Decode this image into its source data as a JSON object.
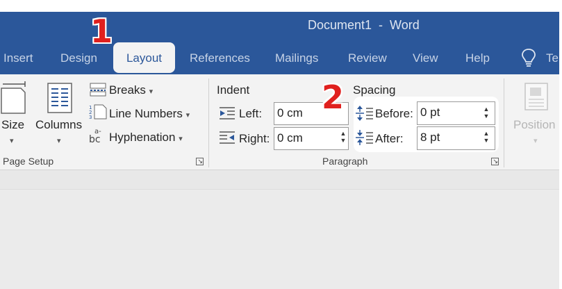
{
  "window": {
    "title": "Document1  -  Word"
  },
  "tabs": [
    "Insert",
    "Design",
    "Layout",
    "References",
    "Mailings",
    "Review",
    "View",
    "Help"
  ],
  "active_tab": "Layout",
  "tell_me_partial": "Te",
  "page_setup": {
    "size_label": "Size",
    "columns_label": "Columns",
    "breaks_label": "Breaks",
    "line_numbers_label": "Line Numbers",
    "hyphenation_label": "Hyphenation",
    "group_label": "Page Setup"
  },
  "paragraph": {
    "indent_header": "Indent",
    "spacing_header": "Spacing",
    "left_label": "Left:",
    "left_value": "0 cm",
    "right_label": "Right:",
    "right_value": "0 cm",
    "before_label": "Before:",
    "before_value": "0 pt",
    "after_label": "After:",
    "after_value": "8 pt",
    "group_label": "Paragraph"
  },
  "arrange": {
    "position_label": "Position"
  },
  "annotations": {
    "step1": "1",
    "step2": "2"
  },
  "colors": {
    "title_bar": "#2b579a",
    "ribbon": "#f3f3f3",
    "badge": "#e0201e"
  },
  "icons": [
    "size-icon",
    "columns-icon",
    "breaks-icon",
    "line-numbers-icon",
    "hyphenation-icon",
    "indent-left-icon",
    "indent-right-icon",
    "spacing-before-icon",
    "spacing-after-icon",
    "position-icon",
    "lightbulb-icon",
    "dialog-launcher-icon"
  ]
}
